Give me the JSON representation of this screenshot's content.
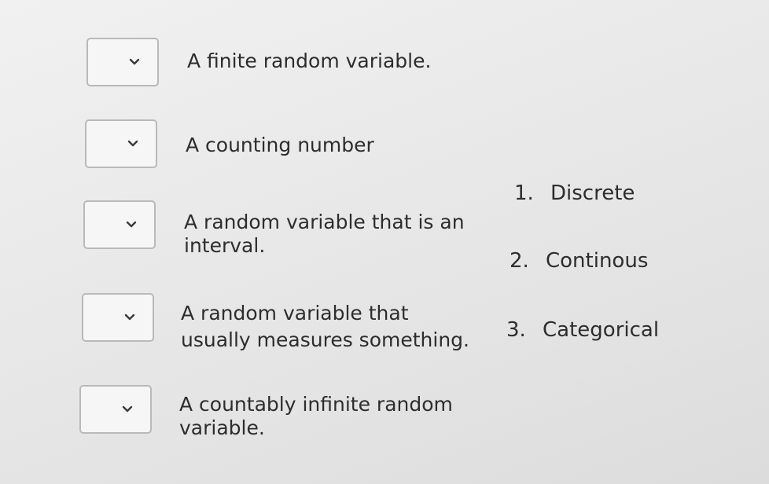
{
  "prompts": [
    {
      "text_lines": [
        "A finite random variable."
      ]
    },
    {
      "text_lines": [
        "A counting number"
      ]
    },
    {
      "text_lines": [
        "A random variable that is an",
        "interval."
      ]
    },
    {
      "text_lines": [
        "A random variable that",
        "usually measures something."
      ]
    },
    {
      "text_lines": [
        "A countably infinite random",
        "variable."
      ]
    }
  ],
  "answers": [
    {
      "number": "1.",
      "label": "Discrete"
    },
    {
      "number": "2.",
      "label": "Continous"
    },
    {
      "number": "3.",
      "label": "Categorical"
    }
  ],
  "icons": {
    "dropdown": "chevron-down-icon"
  },
  "colors": {
    "text": "#2d2d2d",
    "box_border": "#b9b9b9",
    "box_bg": "#f6f6f6"
  }
}
